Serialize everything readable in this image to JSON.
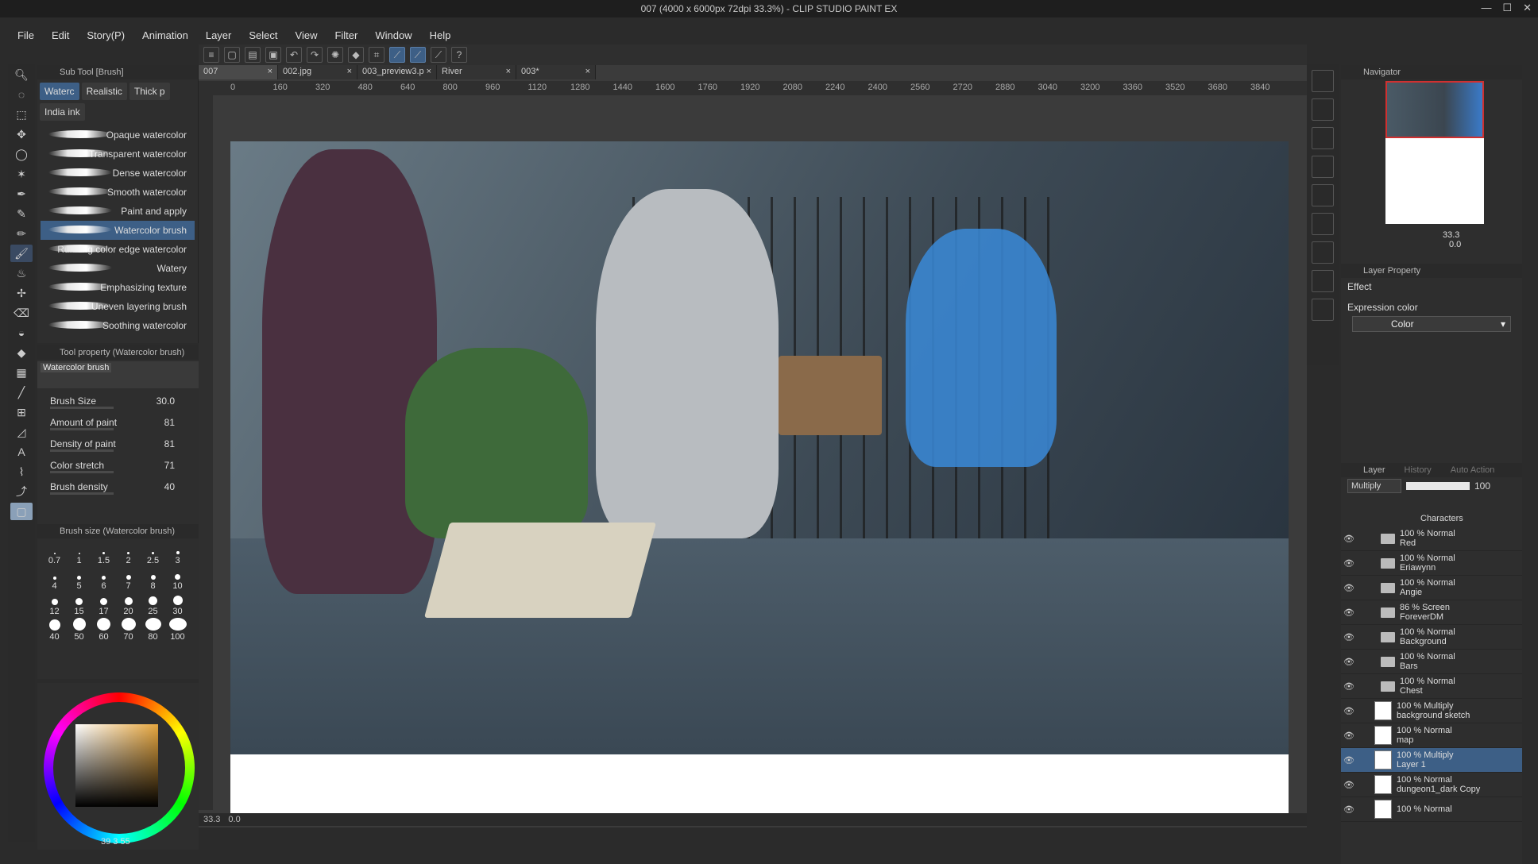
{
  "window": {
    "title": "007 (4000 x 6000px 72dpi 33.3%) - CLIP STUDIO PAINT EX"
  },
  "menu": [
    "File",
    "Edit",
    "Story(P)",
    "Animation",
    "Layer",
    "Select",
    "View",
    "Filter",
    "Window",
    "Help"
  ],
  "subtool": {
    "header": "Sub Tool [Brush]",
    "tabs": [
      "Waterc",
      "Realistic",
      "Thick p",
      "India ink"
    ],
    "brushes": [
      {
        "label": "Opaque watercolor",
        "active": false
      },
      {
        "label": "Transparent watercolor",
        "active": false
      },
      {
        "label": "Dense watercolor",
        "active": false
      },
      {
        "label": "Smooth watercolor",
        "active": false
      },
      {
        "label": "Paint and apply",
        "active": false
      },
      {
        "label": "Watercolor brush",
        "active": true
      },
      {
        "label": "Running color edge watercolor",
        "active": false
      },
      {
        "label": "Watery",
        "active": false
      },
      {
        "label": "Emphasizing texture",
        "active": false
      },
      {
        "label": "Uneven layering brush",
        "active": false
      },
      {
        "label": "Soothing watercolor",
        "active": false
      }
    ]
  },
  "tool_property": {
    "header": "Tool property (Watercolor brush)",
    "preview_label": "Watercolor brush",
    "props": [
      {
        "label": "Brush Size",
        "value": "30.0"
      },
      {
        "label": "Amount of paint",
        "value": "81"
      },
      {
        "label": "Density of paint",
        "value": "81"
      },
      {
        "label": "Color stretch",
        "value": "71"
      },
      {
        "label": "Brush density",
        "value": "40"
      }
    ]
  },
  "brush_size": {
    "header": "Brush size (Watercolor brush)",
    "sizes": [
      "0.7",
      "1",
      "1.5",
      "2",
      "2.5",
      "3",
      "4",
      "5",
      "6",
      "7",
      "8",
      "10",
      "12",
      "15",
      "17",
      "20",
      "25",
      "30",
      "40",
      "50",
      "60",
      "70",
      "80",
      "100"
    ]
  },
  "color": {
    "footer": "39  3  55"
  },
  "documents": [
    {
      "name": "007",
      "active": true
    },
    {
      "name": "002.jpg",
      "active": false
    },
    {
      "name": "003_preview3.p",
      "active": false
    },
    {
      "name": "River",
      "active": false
    },
    {
      "name": "003*",
      "active": false
    }
  ],
  "ruler": [
    "0",
    "160",
    "320",
    "480",
    "640",
    "800",
    "960",
    "1120",
    "1280",
    "1440",
    "1600",
    "1760",
    "1920",
    "2080",
    "2240",
    "2400",
    "2560",
    "2720",
    "2880",
    "3040",
    "3200",
    "3360",
    "3520",
    "3680",
    "3840"
  ],
  "status": {
    "zoom": "33.3",
    "angle": "0.0"
  },
  "navigator": {
    "header": "Navigator",
    "zoom": "33.3",
    "rotation": "0.0"
  },
  "layer_property": {
    "header": "Layer Property",
    "effect": "Effect",
    "expression_label": "Expression color",
    "expression_value": "Color"
  },
  "layer_panel": {
    "header": "Layer",
    "tabs": [
      "History",
      "Auto Action"
    ],
    "blend": "Multiply",
    "opacity": "100",
    "top_label": "Characters",
    "layers": [
      {
        "mode": "100 % Normal",
        "name": "Red",
        "type": "folder",
        "sel": false
      },
      {
        "mode": "100 % Normal",
        "name": "Eriawynn",
        "type": "folder",
        "sel": false
      },
      {
        "mode": "100 % Normal",
        "name": "Angie",
        "type": "folder",
        "sel": false
      },
      {
        "mode": "86 % Screen",
        "name": "ForeverDM",
        "type": "folder",
        "sel": false
      },
      {
        "mode": "100 % Normal",
        "name": "Background",
        "type": "folder",
        "sel": false
      },
      {
        "mode": "100 % Normal",
        "name": "Bars",
        "type": "folder",
        "sel": false
      },
      {
        "mode": "100 % Normal",
        "name": "Chest",
        "type": "folder",
        "sel": false
      },
      {
        "mode": "100 % Multiply",
        "name": "background sketch",
        "type": "layer",
        "sel": false
      },
      {
        "mode": "100 % Normal",
        "name": "map",
        "type": "layer",
        "sel": false
      },
      {
        "mode": "100 % Multiply",
        "name": "Layer 1",
        "type": "layer",
        "sel": true
      },
      {
        "mode": "100 % Normal",
        "name": "dungeon1_dark Copy",
        "type": "layer",
        "sel": false
      },
      {
        "mode": "100 % Normal",
        "name": "",
        "type": "layer",
        "sel": false
      }
    ]
  }
}
